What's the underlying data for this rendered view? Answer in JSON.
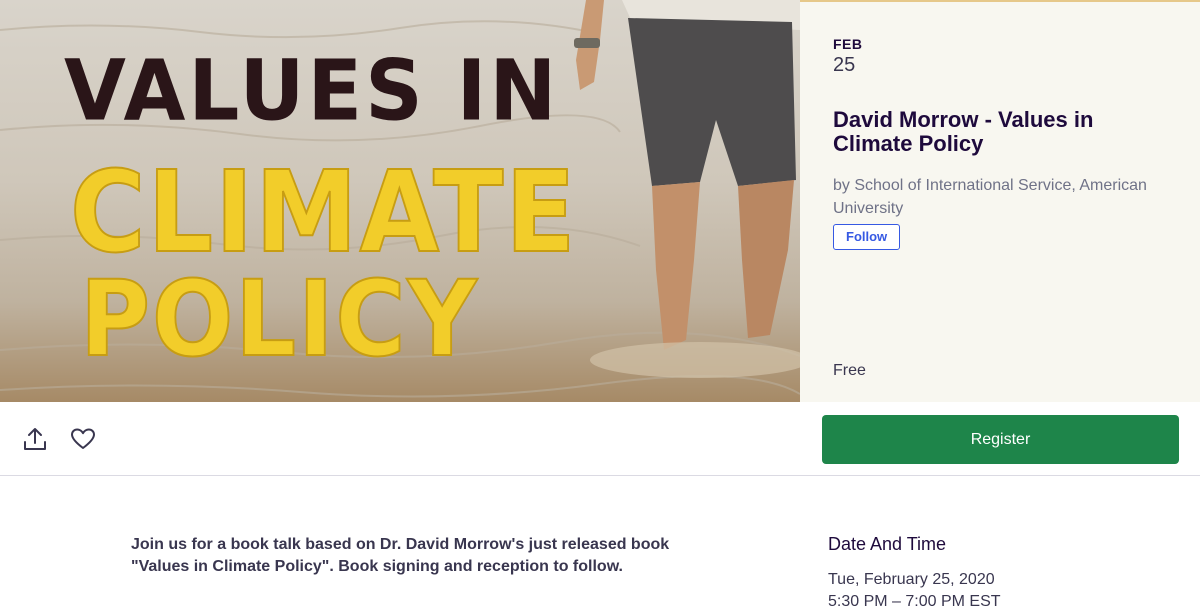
{
  "hero": {
    "cover_text": [
      "VALUES IN",
      "CLIMATE",
      "POLICY"
    ],
    "date_month": "FEB",
    "date_day": "25",
    "title": "David Morrow - Values in Climate Policy",
    "organizer": "by School of International Service, American University",
    "follow_label": "Follow",
    "price": "Free"
  },
  "actions": {
    "share_icon": "share-upload-icon",
    "like_icon": "heart-icon",
    "register_label": "Register"
  },
  "description": {
    "lines": [
      "Join us for a book talk based on Dr. David Morrow's just released book",
      "\"Values in Climate Policy\". Book signing and reception to follow."
    ]
  },
  "date_and_time": {
    "heading": "Date And Time",
    "date": "Tue, February 25, 2020",
    "time": "5:30 PM – 7:00 PM EST"
  },
  "colors": {
    "accent_green": "#1e854a",
    "follow_blue": "#3659e3",
    "cover_yellow": "#f2cd2a",
    "title_navy": "#1e0a3c"
  }
}
